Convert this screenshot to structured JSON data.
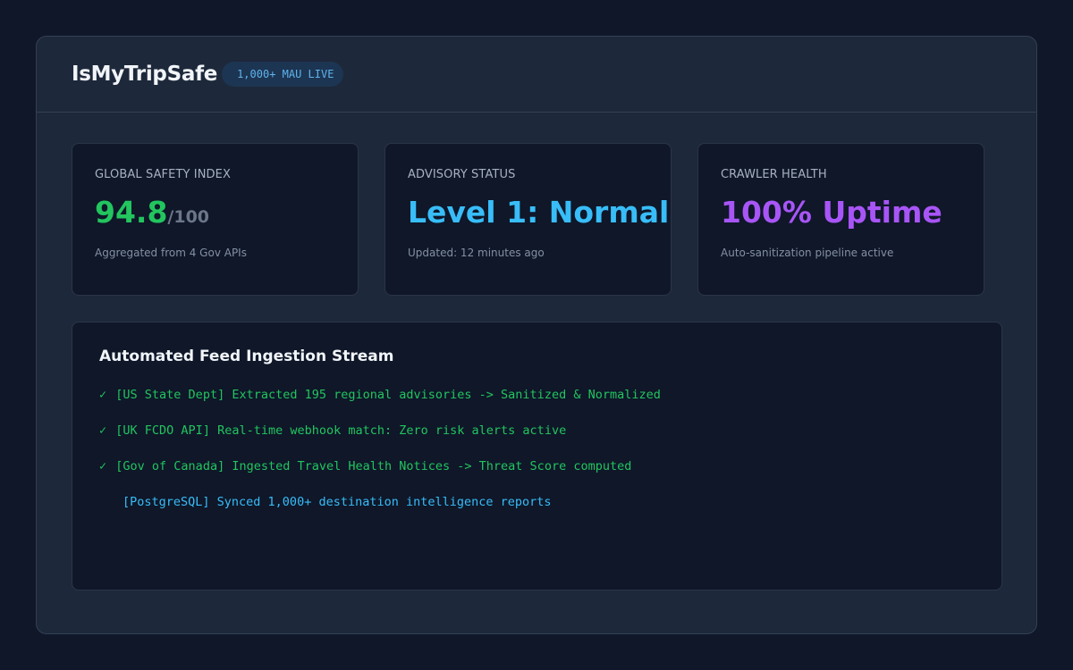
{
  "header": {
    "brand": "IsMyTripSafe",
    "badge": "1,000+ MAU LIVE"
  },
  "cards": [
    {
      "label": "GLOBAL SAFETY INDEX",
      "value": "94.8",
      "suffix": "/100",
      "note": "Aggregated from 4 Gov APIs",
      "color": "#22c55e"
    },
    {
      "label": "ADVISORY STATUS",
      "value": "Level 1: Normal",
      "note": "Updated: 12 minutes ago",
      "color": "#38bdf8"
    },
    {
      "label": "CRAWLER HEALTH",
      "value": "100% Uptime",
      "note": "Auto-sanitization pipeline active",
      "color": "#a855f7"
    }
  ],
  "stream": {
    "title": "Automated Feed Ingestion Stream",
    "check_glyph": "✓",
    "lines": [
      "[US State Dept] Extracted 195 regional advisories -> Sanitized & Normalized",
      "[UK FCDO API] Real-time webhook match: Zero risk alerts active",
      "[Gov of Canada] Ingested Travel Health Notices -> Threat Score computed",
      "[PostgreSQL] Synced 1,000+ destination intelligence reports"
    ]
  }
}
